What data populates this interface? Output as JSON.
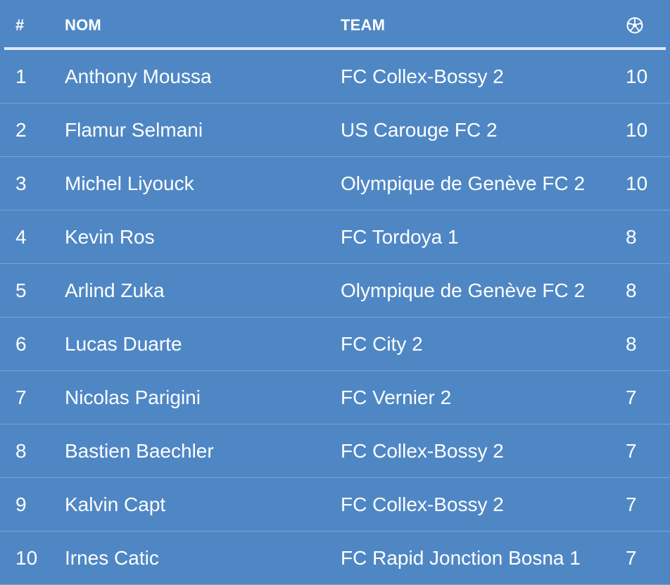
{
  "header": {
    "rank_label": "#",
    "name_label": "NOM",
    "team_label": "TEAM",
    "goals_icon": "soccer-ball-icon"
  },
  "colors": {
    "background": "#4f87c5",
    "text": "#ffffff",
    "header_rule": "#dde8f4",
    "row_divider": "#78a3d4"
  },
  "rows": [
    {
      "rank": "1",
      "name": "Anthony Moussa",
      "team": "FC Collex-Bossy 2",
      "goals": "10"
    },
    {
      "rank": "2",
      "name": "Flamur Selmani",
      "team": "US Carouge FC 2",
      "goals": "10"
    },
    {
      "rank": "3",
      "name": "Michel Liyouck",
      "team": "Olympique de Genève FC 2",
      "goals": "10"
    },
    {
      "rank": "4",
      "name": "Kevin Ros",
      "team": "FC Tordoya 1",
      "goals": "8"
    },
    {
      "rank": "5",
      "name": "Arlind Zuka",
      "team": "Olympique de Genève FC 2",
      "goals": "8"
    },
    {
      "rank": "6",
      "name": "Lucas Duarte",
      "team": "FC City 2",
      "goals": "8"
    },
    {
      "rank": "7",
      "name": "Nicolas Parigini",
      "team": "FC Vernier 2",
      "goals": "7"
    },
    {
      "rank": "8",
      "name": "Bastien Baechler",
      "team": "FC Collex-Bossy 2",
      "goals": "7"
    },
    {
      "rank": "9",
      "name": "Kalvin Capt",
      "team": "FC Collex-Bossy 2",
      "goals": "7"
    },
    {
      "rank": "10",
      "name": "Irnes Catic",
      "team": "FC Rapid Jonction Bosna 1",
      "goals": "7"
    }
  ]
}
